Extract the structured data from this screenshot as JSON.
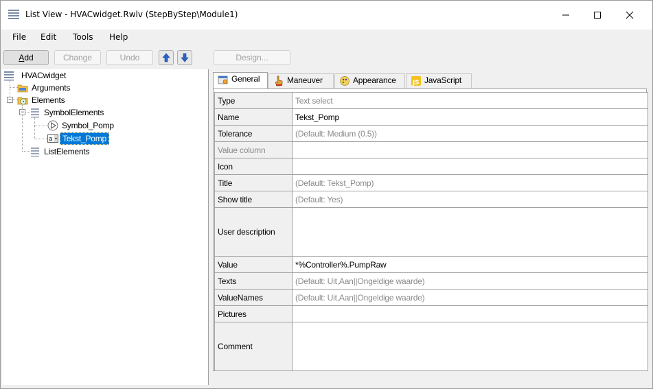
{
  "window": {
    "title": "List View - HVACwidget.Rwlv (StepByStep\\Module1)"
  },
  "menu": [
    {
      "label": "File"
    },
    {
      "label": "Edit"
    },
    {
      "label": "Tools"
    },
    {
      "label": "Help"
    }
  ],
  "toolbar": {
    "add": "Add",
    "change": "Change",
    "undo": "Undo",
    "design": "Design..."
  },
  "tree": {
    "root": "HVACwidget",
    "arguments": "Arguments",
    "elements": "Elements",
    "symbol_elements": "SymbolElements",
    "symbol_pomp": "Symbol_Pomp",
    "tekst_pomp": "Tekst_Pomp",
    "list_elements": "ListElements"
  },
  "tabs": [
    {
      "label": "General"
    },
    {
      "label": "Maneuver"
    },
    {
      "label": "Appearance"
    },
    {
      "label": "JavaScript"
    }
  ],
  "properties": [
    {
      "key": "Type",
      "value": "Text select"
    },
    {
      "key": "Name",
      "value": "Tekst_Pomp"
    },
    {
      "key": "Tolerance",
      "value": "(Default: Medium (0.5))"
    },
    {
      "key": "Value column",
      "value": ""
    },
    {
      "key": "Icon",
      "value": ""
    },
    {
      "key": "Title",
      "value": "(Default: Tekst_Pomp)"
    },
    {
      "key": "Show title",
      "value": "(Default: Yes)"
    },
    {
      "key": "User description",
      "value": ""
    },
    {
      "key": "Value",
      "value": "*%Controller%.PumpRaw"
    },
    {
      "key": "Texts",
      "value": "(Default: Uit,Aan||Ongeldige waarde)"
    },
    {
      "key": "ValueNames",
      "value": "(Default: Uit,Aan||Ongeldige waarde)"
    },
    {
      "key": "Pictures",
      "value": ""
    },
    {
      "key": "Comment",
      "value": ""
    }
  ]
}
